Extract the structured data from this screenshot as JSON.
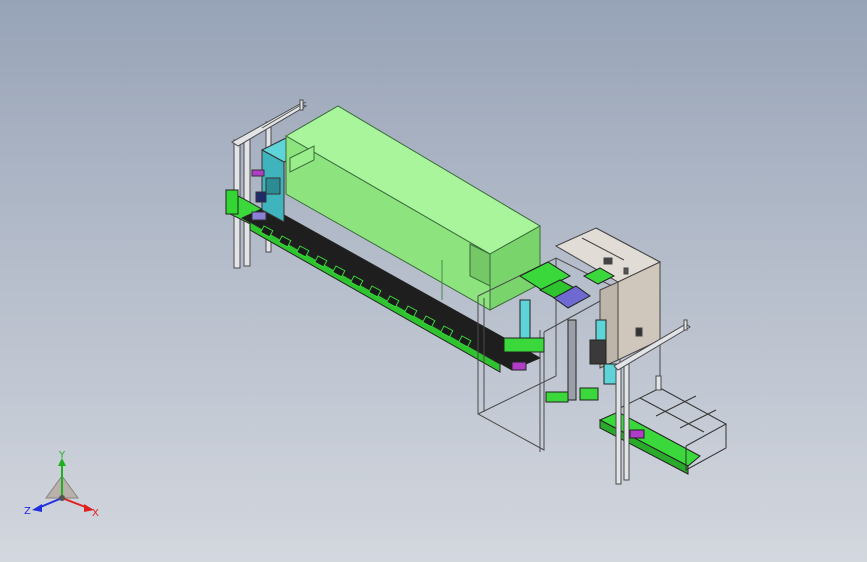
{
  "viewport": {
    "background_top": "#97a3b7",
    "background_bottom": "#d3d7de"
  },
  "model": {
    "frame_color": "#d8dade",
    "enclosure_color": "#86ea7a",
    "conveyor_color": "#34d634",
    "cabinet_color": "#d4ccc4",
    "accent_cyan": "#4fc6cc",
    "accent_magenta": "#b03cc8",
    "accent_purple": "#6e6ad2"
  },
  "triad": {
    "y_label": "Y",
    "z_label": "Z",
    "x_label": "X",
    "y_color": "#1fb01f",
    "z_color": "#1f2fe0",
    "x_color": "#e01f1f"
  }
}
